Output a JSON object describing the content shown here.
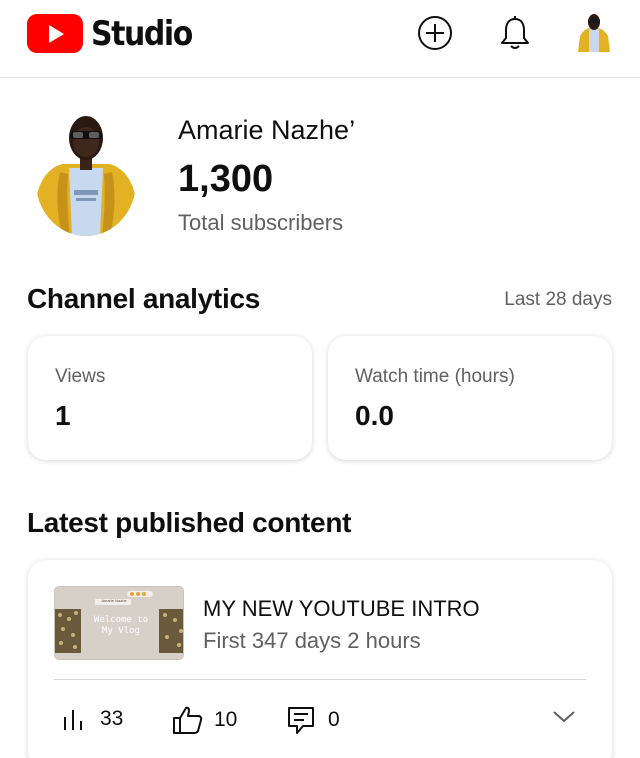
{
  "header": {
    "app_name": "Studio",
    "icons": [
      "youtube-logo-icon",
      "create-icon",
      "notifications-bell-icon",
      "account-avatar"
    ]
  },
  "channel": {
    "name": "Amarie Nazhe’",
    "subscriber_count": "1,300",
    "subscriber_label": "Total subscribers"
  },
  "analytics": {
    "title": "Channel analytics",
    "period": "Last 28 days",
    "cards": [
      {
        "label": "Views",
        "value": "1"
      },
      {
        "label": "Watch time (hours)",
        "value": "0.0"
      }
    ]
  },
  "latest": {
    "title": "Latest published content",
    "video": {
      "thumbnail_text": "Welcome to My Vlog",
      "thumbnail_caption": "Amarie Nazhe",
      "title": "MY NEW YOUTUBE INTRO",
      "meta": "First 347 days 2 hours",
      "views": "33",
      "likes": "10",
      "comments": "0"
    }
  },
  "colors": {
    "brand_red": "#ff0000",
    "text_primary": "#0f0f0f",
    "text_secondary": "#606060",
    "avatar_jacket": "#e2b124"
  }
}
